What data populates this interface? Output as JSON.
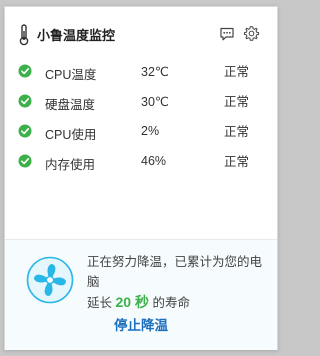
{
  "header": {
    "title": "小鲁温度监控"
  },
  "metrics": [
    {
      "label": "CPU温度",
      "value": "32℃",
      "status": "正常"
    },
    {
      "label": "硬盘温度",
      "value": "30℃",
      "status": "正常"
    },
    {
      "label": "CPU使用",
      "value": "2%",
      "status": "正常"
    },
    {
      "label": "内存使用",
      "value": "46%",
      "status": "正常"
    }
  ],
  "cooling": {
    "line1": "正在努力降温，已累计为您的电脑",
    "prefix": "延长",
    "seconds": "20 秒",
    "suffix": "的寿命",
    "stop_label": "停止降温"
  },
  "colors": {
    "ok": "#3cb049",
    "accent": "#1a6fbf",
    "fan": "#29b7e8"
  }
}
